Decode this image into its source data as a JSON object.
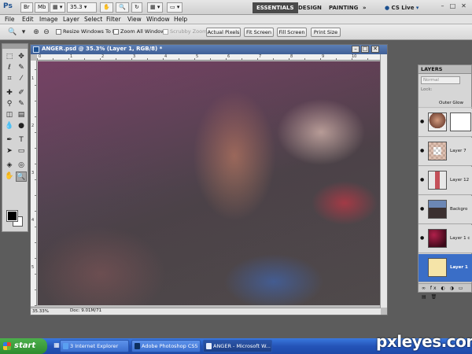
{
  "appbar": {
    "logo": "Ps",
    "zoom_value": "35.3",
    "workspaces": [
      "ESSENTIALS",
      "DESIGN",
      "PAINTING"
    ],
    "more": "»",
    "cslive": "CS Live",
    "window_controls": [
      "–",
      "□",
      "✕"
    ]
  },
  "menus": [
    "File",
    "Edit",
    "Image",
    "Layer",
    "Select",
    "Filter",
    "View",
    "Window",
    "Help"
  ],
  "options": {
    "resize_windows": "Resize Windows To Fit",
    "zoom_all": "Zoom All Windows",
    "scrubby_zoom": "Scrubby Zoom",
    "buttons": [
      "Actual Pixels",
      "Fit Screen",
      "Fill Screen",
      "Print Size"
    ]
  },
  "document": {
    "title": "ANGER.psd @ 35.3% (Layer 1, RGB/8) *",
    "zoom": "35.33%",
    "doc_size": "Doc: 9.01M/71.9M",
    "ruler_h": [
      "0",
      "1",
      "2",
      "3",
      "4",
      "5",
      "6",
      "7",
      "8",
      "9",
      "10"
    ],
    "ruler_v": [
      "1",
      "2",
      "3",
      "4",
      "5"
    ]
  },
  "layers": {
    "tab": "LAYERS",
    "blend_mode": "Normal",
    "lock_label": "Lock:",
    "effect": "Outer Glow",
    "items": [
      {
        "name": "",
        "visible": true,
        "selected": false
      },
      {
        "name": "Layer 7",
        "visible": true,
        "selected": false
      },
      {
        "name": "Layer 12",
        "visible": true,
        "selected": false
      },
      {
        "name": "Backgro",
        "visible": true,
        "selected": false
      },
      {
        "name": "Layer 1 c",
        "visible": true,
        "selected": false
      },
      {
        "name": "Layer 1",
        "visible": false,
        "selected": true
      }
    ],
    "footer": "∞ fx ◐ ◑ ▭ ▤ 🗑"
  },
  "taskbar": {
    "start": "start",
    "tasks": [
      "3 Internet Explorer",
      "Adobe Photoshop CS5",
      "ANGER - Microsoft W..."
    ]
  },
  "watermark": "pxleyes.com",
  "colors": {
    "foreground": "#000000",
    "background": "#ffffff",
    "selection": "#3a6ec7"
  }
}
